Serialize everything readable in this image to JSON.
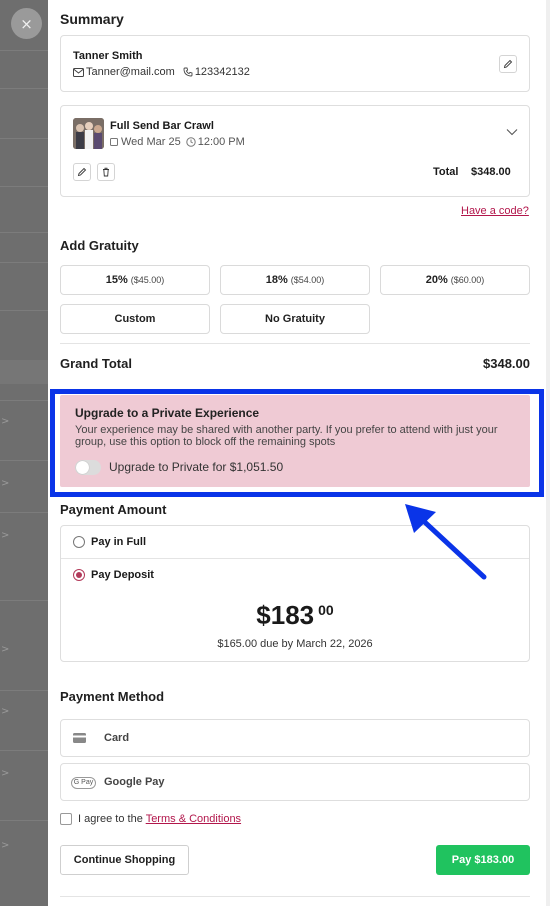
{
  "colors": {
    "accent": "#b2164b",
    "highlight": "#0a34e8",
    "upgrade_bg": "#efcad4",
    "pay_button": "#20c35f"
  },
  "summary": {
    "title": "Summary",
    "customer": {
      "name": "Tanner Smith",
      "email": "Tanner@mail.com",
      "phone": "123342132"
    },
    "event": {
      "name": "Full Send Bar Crawl",
      "date": "Wed Mar 25",
      "time": "12:00 PM"
    },
    "total_label": "Total",
    "total_value": "$348.00",
    "promo_link": "Have a code?"
  },
  "gratuity": {
    "title": "Add Gratuity",
    "options": [
      {
        "label": "15%",
        "amount": "($45.00)"
      },
      {
        "label": "18%",
        "amount": "($54.00)"
      },
      {
        "label": "20%",
        "amount": "($60.00)"
      }
    ],
    "custom_label": "Custom",
    "none_label": "No Gratuity"
  },
  "grand_total": {
    "label": "Grand Total",
    "value": "$348.00"
  },
  "upgrade": {
    "title": "Upgrade to a Private Experience",
    "description": "Your experience may be shared with another party. If you prefer to attend with just your group, use this option to block off the remaining spots",
    "toggle_label": "Upgrade to Private for $1,051.50",
    "toggle_on": false
  },
  "payment_amount": {
    "title": "Payment Amount",
    "pay_full_label": "Pay in Full",
    "pay_deposit_label": "Pay Deposit",
    "selected": "Pay Deposit",
    "deposit_dollars": "$183",
    "deposit_cents": "00",
    "due_note": "$165.00 due by March 22, 2026"
  },
  "payment_method": {
    "title": "Payment Method",
    "card_label": "Card",
    "google_pay_label": "Google Pay",
    "gpay_badge": "G Pay"
  },
  "terms": {
    "prefix": "I agree to the ",
    "link": "Terms & Conditions"
  },
  "footer": {
    "continue_label": "Continue Shopping",
    "pay_label": "Pay $183.00"
  },
  "close_icon": "×"
}
